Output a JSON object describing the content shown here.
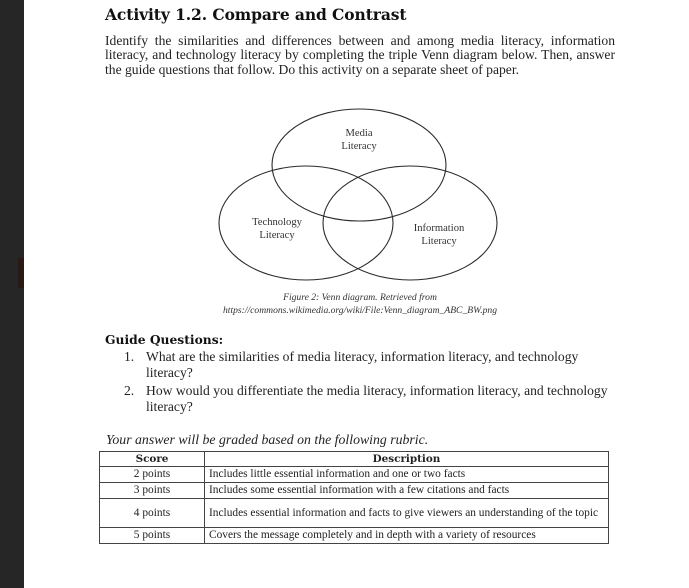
{
  "activity": {
    "title": "Activity 1.2. Compare and Contrast",
    "intro": "Identify the similarities and differences between and among media literacy, information literacy, and technology literacy by completing the triple Venn diagram below. Then, answer the guide questions that follow. Do this activity on a separate sheet of paper."
  },
  "venn": {
    "circles": [
      {
        "name": "media",
        "label_line1": "Media",
        "label_line2": "Literacy"
      },
      {
        "name": "technology",
        "label_line1": "Technology",
        "label_line2": "Literacy"
      },
      {
        "name": "information",
        "label_line1": "Information",
        "label_line2": "Literacy"
      }
    ],
    "caption_line1": "Figure 2: Venn diagram. Retrieved from",
    "caption_line2": "https://commons.wikimedia.org/wiki/File:Venn_diagram_ABC_BW.png"
  },
  "guide": {
    "heading": "Guide Questions:",
    "questions": [
      {
        "num": "1.",
        "text": "What are the similarities of media literacy, information literacy, and technology literacy?"
      },
      {
        "num": "2.",
        "text": "How would you differentiate the media literacy, information literacy, and technology literacy?"
      }
    ]
  },
  "rubric": {
    "intro": "Your answer will be graded based on the following rubric.",
    "headers": {
      "score": "Score",
      "description": "Description"
    },
    "rows": [
      {
        "score": "2 points",
        "description": "Includes little essential information and one or two facts"
      },
      {
        "score": "3 points",
        "description": "Includes some essential information with a few citations and facts"
      },
      {
        "score": "4 points",
        "description": "Includes essential information and facts to give viewers an understanding of the topic"
      },
      {
        "score": "5 points",
        "description": "Covers the message completely and in depth with a variety of resources"
      }
    ]
  }
}
